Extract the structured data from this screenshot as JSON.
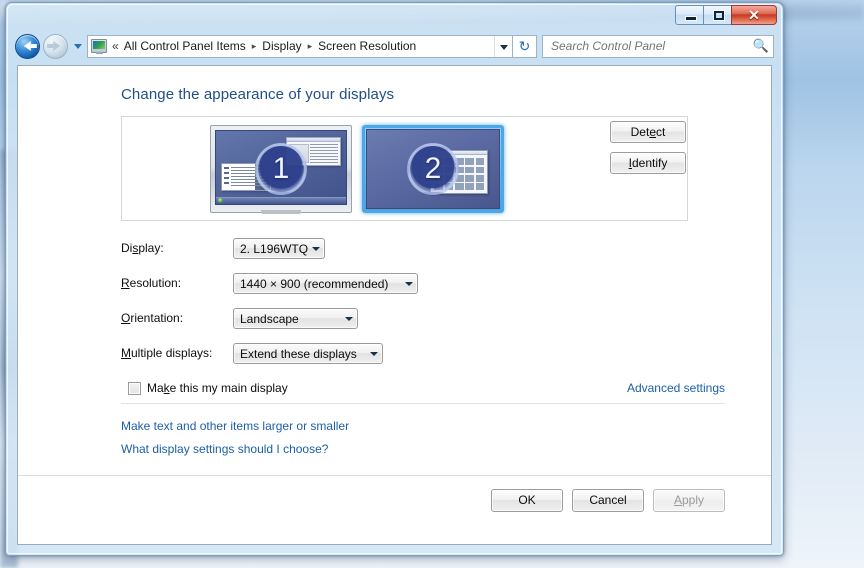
{
  "window": {
    "caption_buttons": {
      "minimize": "Minimize",
      "maximize": "Maximize",
      "close": "✕"
    }
  },
  "navbar": {
    "back_tooltip": "Back",
    "forward_tooltip": "Forward",
    "recent_pages_tooltip": "Recent pages",
    "address_icon": "monitor-icon",
    "breadcrumb_prefix": "«",
    "breadcrumbs": [
      {
        "label": "All Control Panel Items"
      },
      {
        "label": "Display"
      },
      {
        "label": "Screen Resolution"
      }
    ],
    "breadcrumb_separator": "▸",
    "refresh_icon": "↻",
    "search": {
      "placeholder": "Search Control Panel",
      "value": "",
      "icon": "search-icon"
    }
  },
  "main": {
    "page_title": "Change the appearance of your displays",
    "preview": {
      "monitors": [
        {
          "number": "1",
          "selected": false
        },
        {
          "number": "2",
          "selected": true
        }
      ]
    },
    "preview_actions": {
      "detect": {
        "pre": "Det",
        "accel": "e",
        "post": "ct"
      },
      "identify": {
        "pre": "",
        "accel": "I",
        "post": "dentify"
      }
    },
    "fields": {
      "display": {
        "label_pre": "Di",
        "label_accel": "s",
        "label_post": "play:",
        "value": "2. L196WTQ"
      },
      "resolution": {
        "label_pre": "",
        "label_accel": "R",
        "label_post": "esolution:",
        "value": "1440 × 900 (recommended)"
      },
      "orientation": {
        "label_pre": "",
        "label_accel": "O",
        "label_post": "rientation:",
        "value": "Landscape"
      },
      "multiple_displays": {
        "label_pre": "",
        "label_accel": "M",
        "label_post": "ultiple displays:",
        "value": "Extend these displays"
      }
    },
    "main_display_checkbox": {
      "pre": "Ma",
      "accel": "k",
      "post": "e this my main display",
      "checked": false
    },
    "advanced_settings_link": "Advanced settings",
    "links": [
      {
        "label": "Make text and other items larger or smaller"
      },
      {
        "label": "What display settings should I choose?"
      }
    ]
  },
  "footer": {
    "ok": "OK",
    "cancel": "Cancel",
    "apply": {
      "pre": "",
      "accel": "A",
      "post": "pply",
      "disabled": true
    }
  },
  "colors": {
    "accent_link": "#1c5fa8",
    "title_text": "#1f4f86",
    "selection_blue": "#4aa8e8",
    "close_red": "#c33a24"
  }
}
